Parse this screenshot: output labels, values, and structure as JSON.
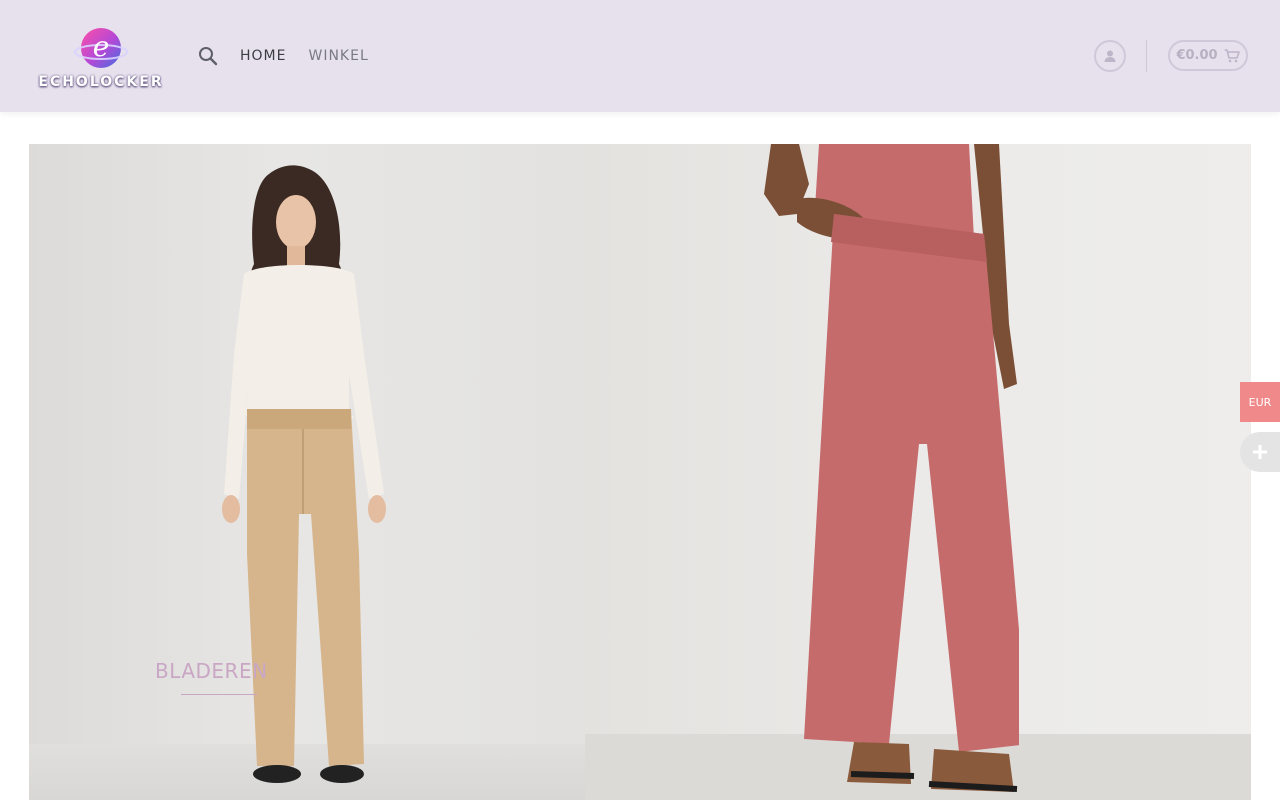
{
  "brand": {
    "name": "ECHOLOCKER",
    "logo_letter": "e"
  },
  "nav": {
    "items": [
      {
        "label": "HOME"
      },
      {
        "label": "WINKEL"
      }
    ]
  },
  "header": {
    "cart_total": "€0.00"
  },
  "hero": {
    "cta_label": "BLADEREN"
  },
  "widgets": {
    "currency": "EUR"
  },
  "icons": {
    "search": "search-icon",
    "account": "user-icon",
    "cart": "cart-icon",
    "plus": "plus-icon"
  },
  "colors": {
    "header_bg": "#e7e1ee",
    "cta": "#c9a7c4",
    "currency_tab": "#f08a8a",
    "left_pants": "#d6b58c",
    "right_pants": "#c66b6c"
  }
}
